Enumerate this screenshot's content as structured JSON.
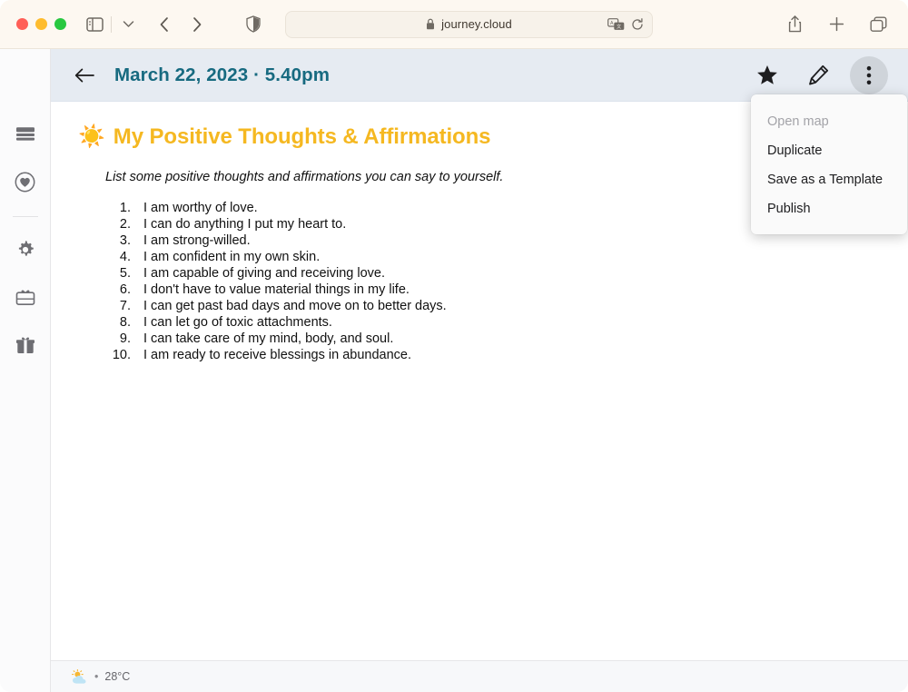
{
  "browser": {
    "traffic_lights": [
      {
        "name": "close",
        "color": "#ff5f57"
      },
      {
        "name": "minimize",
        "color": "#febc2e"
      },
      {
        "name": "maximize",
        "color": "#28c840"
      }
    ],
    "sidebar_toggle": "sidebar-toggle-icon",
    "tab_overview_chevron": "chevron-down-icon",
    "back": "back-chevron-icon",
    "forward": "forward-chevron-icon",
    "shield": "privacy-shield-icon",
    "url": {
      "lock": "lock-icon",
      "text": "journey.cloud",
      "translate": "translate-icon",
      "reload": "reload-icon"
    },
    "share": "share-icon",
    "new_tab": "plus-icon",
    "tabs": "tabs-overview-icon"
  },
  "sidebar": {
    "items": [
      {
        "name": "journal",
        "icon": "journal-stack-icon"
      },
      {
        "name": "favorites",
        "icon": "heart-circle-icon"
      },
      {
        "name": "settings",
        "icon": "gear-icon"
      },
      {
        "name": "membership",
        "icon": "gift-card-icon"
      },
      {
        "name": "rewards",
        "icon": "gift-box-icon"
      }
    ]
  },
  "entry_header": {
    "back_label": "back-arrow",
    "title": "March 22, 2023 · 5.40pm",
    "star": "star-icon",
    "edit": "pencil-icon",
    "more": "more-options-icon"
  },
  "menu": {
    "items": [
      {
        "label": "Open map",
        "disabled": true
      },
      {
        "label": "Duplicate",
        "disabled": false
      },
      {
        "label": "Save as a Template",
        "disabled": false
      },
      {
        "label": "Publish",
        "disabled": false
      }
    ]
  },
  "document": {
    "emoji": "☀️",
    "title": "My Positive Thoughts & Affirmations",
    "subtitle": "List some positive thoughts and affirmations you can say to yourself.",
    "list": [
      "I am worthy of love.",
      "I can do anything I put my heart to.",
      "I am strong-willed.",
      "I am confident in my own skin.",
      "I am capable of giving and receiving love.",
      "I don't have to value material things in my life.",
      "I can get past bad days and move on to better days.",
      "I can let go of toxic attachments.",
      "I can take care of my mind, body, and soul.",
      "I am ready to receive blessings in abundance."
    ]
  },
  "footer": {
    "weather_icon": "sun-behind-cloud-icon",
    "separator": "•",
    "temperature": "28°C"
  },
  "colors": {
    "title_gold": "#f5b821",
    "header_teal": "#176a80",
    "header_bar": "#e6ebf2",
    "chrome": "#fdf8f1"
  }
}
